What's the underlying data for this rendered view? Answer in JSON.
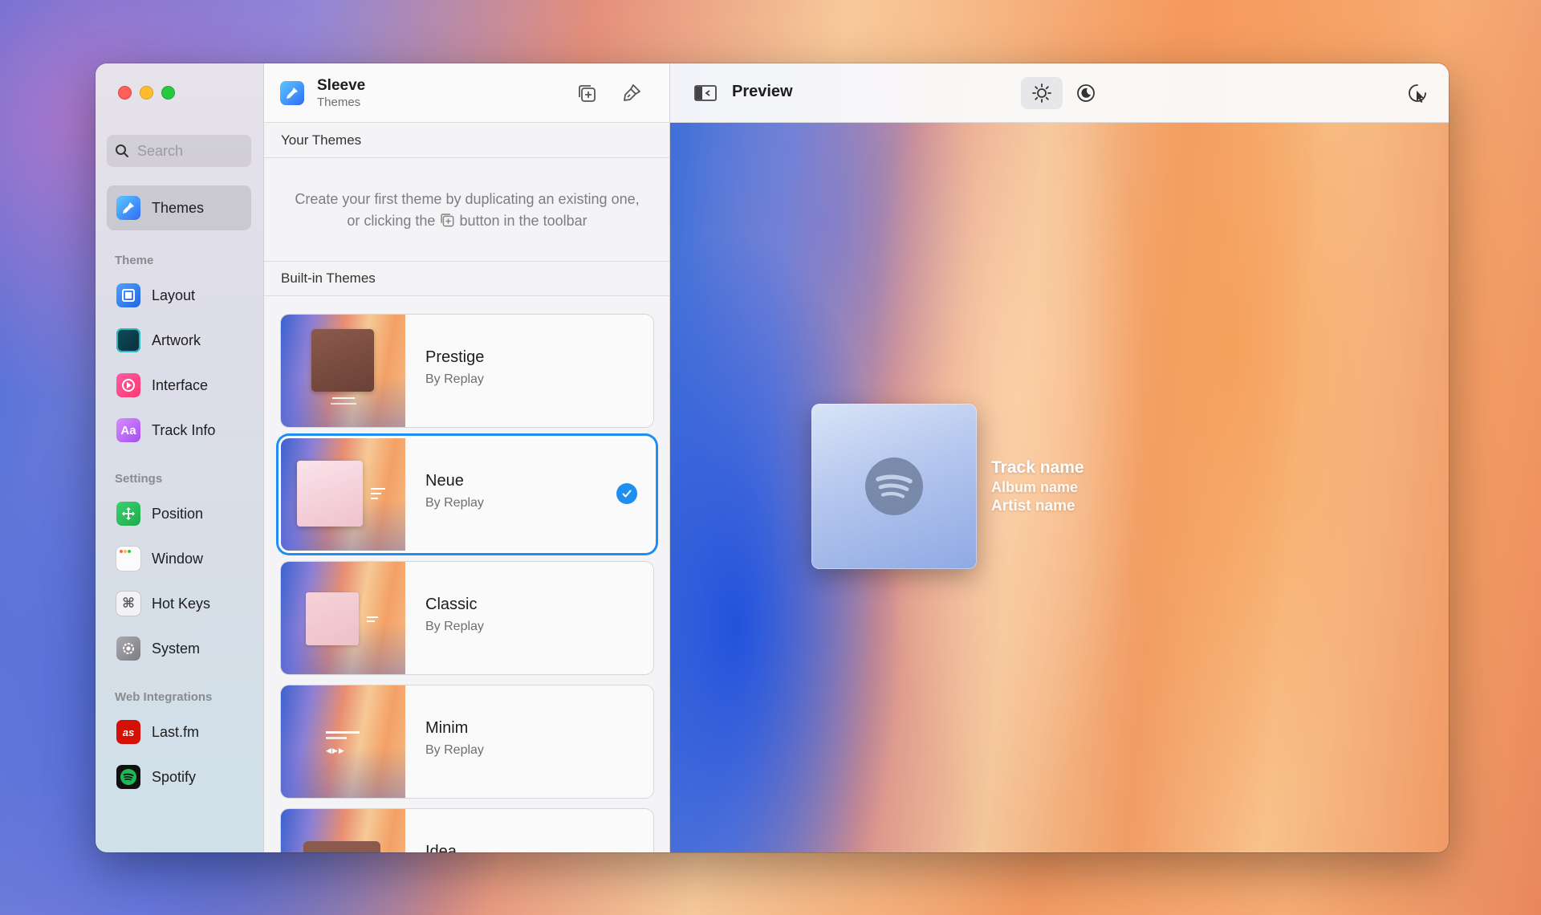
{
  "sidebar": {
    "search_placeholder": "Search",
    "selected_item": "Themes",
    "sections": {
      "theme": "Theme",
      "settings": "Settings",
      "web": "Web Integrations"
    },
    "theme_items": [
      "Layout",
      "Artwork",
      "Interface",
      "Track Info"
    ],
    "settings_items": [
      "Position",
      "Window",
      "Hot Keys",
      "System"
    ],
    "web_items": [
      "Last.fm",
      "Spotify"
    ],
    "icon_glyphs": {
      "track_info": "Aa"
    }
  },
  "middle": {
    "app_name": "Sleeve",
    "app_subtitle": "Themes",
    "your_themes_header": "Your Themes",
    "empty_msg_part1": "Create your first theme by duplicating an existing one, or clicking the",
    "empty_msg_part2": "button in the toolbar",
    "builtin_header": "Built-in Themes",
    "themes": [
      {
        "name": "Prestige",
        "author": "By Replay",
        "selected": false
      },
      {
        "name": "Neue",
        "author": "By Replay",
        "selected": true
      },
      {
        "name": "Classic",
        "author": "By Replay",
        "selected": false
      },
      {
        "name": "Minim",
        "author": "By Replay",
        "selected": false
      },
      {
        "name": "Idea",
        "author": "",
        "selected": false
      }
    ]
  },
  "preview": {
    "title": "Preview",
    "track_name": "Track name",
    "album_name": "Album name",
    "artist_name": "Artist name"
  },
  "colors": {
    "accent": "#1e8ff0",
    "spotify_green": "#1db954",
    "lastfm_red": "#d51007"
  }
}
